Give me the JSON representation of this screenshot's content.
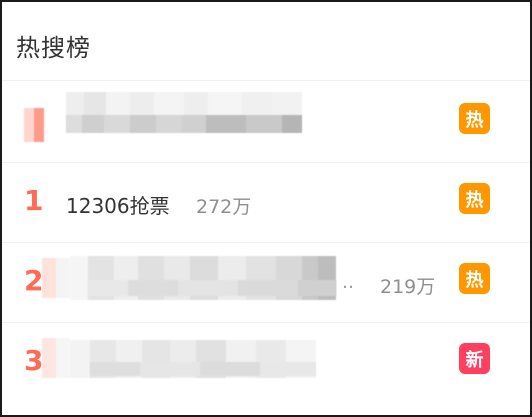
{
  "panel": {
    "title": "热搜榜"
  },
  "items": [
    {
      "rank": "",
      "keyword": "",
      "heat": "",
      "badge": "热",
      "badge_color": "#ff9700"
    },
    {
      "rank": "1",
      "keyword": "12306抢票",
      "heat": "272万",
      "badge": "热",
      "badge_color": "#ff9700"
    },
    {
      "rank": "2",
      "keyword": "",
      "heat": "219万",
      "badge": "热",
      "badge_color": "#ff9700"
    },
    {
      "rank": "3",
      "keyword": "",
      "heat": "",
      "badge": "新",
      "badge_color": "#ff3f60"
    }
  ],
  "colors": {
    "rank": "#ff6b57",
    "heat_text": "#8f8f8f"
  }
}
